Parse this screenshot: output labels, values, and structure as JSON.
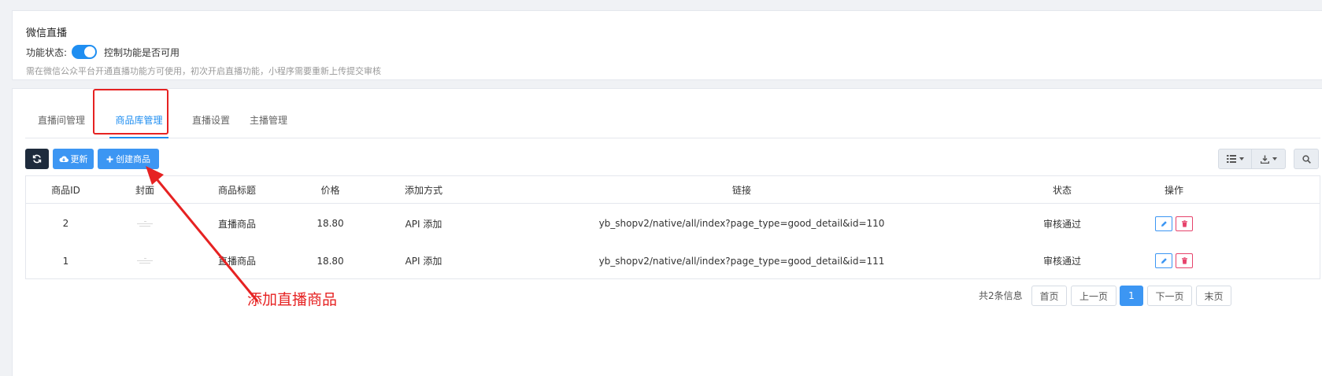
{
  "top": {
    "title": "微信直播",
    "status_label": "功能状态:",
    "toggle_on": true,
    "status_desc": "控制功能是否可用",
    "note": "需在微信公众平台开通直播功能方可使用，初次开启直播功能，小程序需要重新上传提交审核"
  },
  "tabs": [
    {
      "label": "直播间管理",
      "active": false
    },
    {
      "label": "商品库管理",
      "active": true
    },
    {
      "label": "直播设置",
      "active": false
    },
    {
      "label": "主播管理",
      "active": false
    }
  ],
  "toolbar": {
    "refresh_icon": "refresh-icon",
    "update_label": "更新",
    "create_label": "创建商品"
  },
  "table": {
    "headers": [
      "商品ID",
      "封面",
      "商品标题",
      "价格",
      "添加方式",
      "链接",
      "状态",
      "操作"
    ],
    "rows": [
      {
        "id": "2",
        "title": "直播商品",
        "price": "18.80",
        "method": "API 添加",
        "link": "yb_shopv2/native/all/index?page_type=good_detail&id=110",
        "status": "审核通过"
      },
      {
        "id": "1",
        "title": "直播商品",
        "price": "18.80",
        "method": "API 添加",
        "link": "yb_shopv2/native/all/index?page_type=good_detail&id=111",
        "status": "审核通过"
      }
    ]
  },
  "pagination": {
    "total": "共2条信息",
    "first": "首页",
    "prev": "上一页",
    "current": "1",
    "next": "下一页",
    "last": "末页"
  },
  "annotation": {
    "text": "添加直播商品",
    "color": "#e62222"
  },
  "colors": {
    "primary": "#3c96f3",
    "dark_button": "#1e2b3c",
    "danger": "#e6436b"
  }
}
